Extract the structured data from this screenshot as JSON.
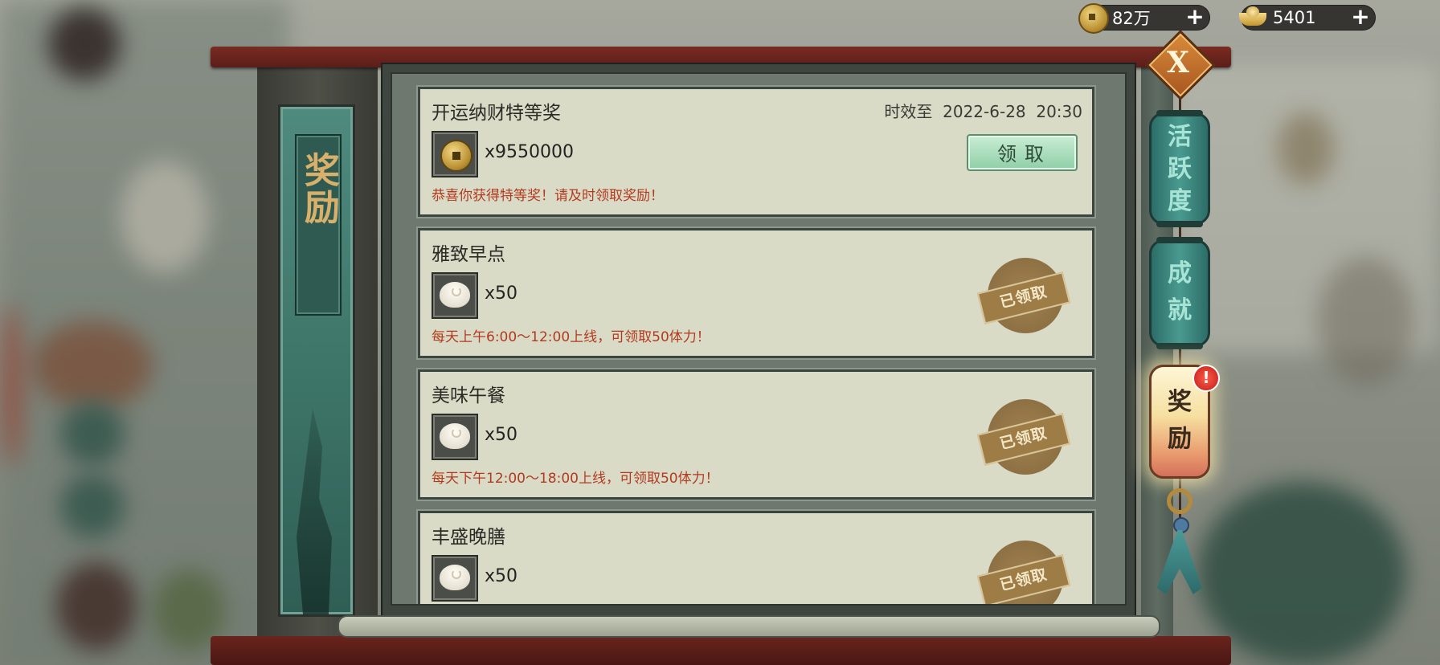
{
  "currency": [
    {
      "icon": "copper-coin-icon",
      "value": "82万"
    },
    {
      "icon": "gold-ingot-icon",
      "value": "5401"
    }
  ],
  "banner": {
    "title": "奖励"
  },
  "rewards": [
    {
      "title": "开运纳财特等奖",
      "expiry": "时效至  2022-6-28  20:30",
      "item_icon": "copper-coin-icon",
      "quantity": "x9550000",
      "description": "恭喜你获得特等奖！请及时领取奖励！",
      "action_label": "领取",
      "claimed": false
    },
    {
      "title": "雅致早点",
      "item_icon": "steamed-bun-icon",
      "quantity": "x50",
      "description": "每天上午6:00～12:00上线，可领取50体力！",
      "stamp_label": "已领取",
      "claimed": true
    },
    {
      "title": "美味午餐",
      "item_icon": "steamed-bun-icon",
      "quantity": "x50",
      "description": "每天下午12:00～18:00上线，可领取50体力！",
      "stamp_label": "已领取",
      "claimed": true
    },
    {
      "title": "丰盛晚膳",
      "item_icon": "steamed-bun-icon",
      "quantity": "x50",
      "stamp_label": "已领取",
      "claimed": true
    }
  ],
  "side_tabs": [
    {
      "label_1": "活",
      "label_2": "跃",
      "label_3": "度",
      "active": false
    },
    {
      "label_1": "成",
      "label_2": "就",
      "active": false
    },
    {
      "label_1": "奖",
      "label_2": "励",
      "active": true,
      "alert": "!"
    }
  ],
  "close_label": "X",
  "colors": {
    "accent_teal": "#3f8a80",
    "claim_green": "#8fcfa6",
    "alert_red": "#d42a1e",
    "desc_red": "#b33a1e"
  }
}
